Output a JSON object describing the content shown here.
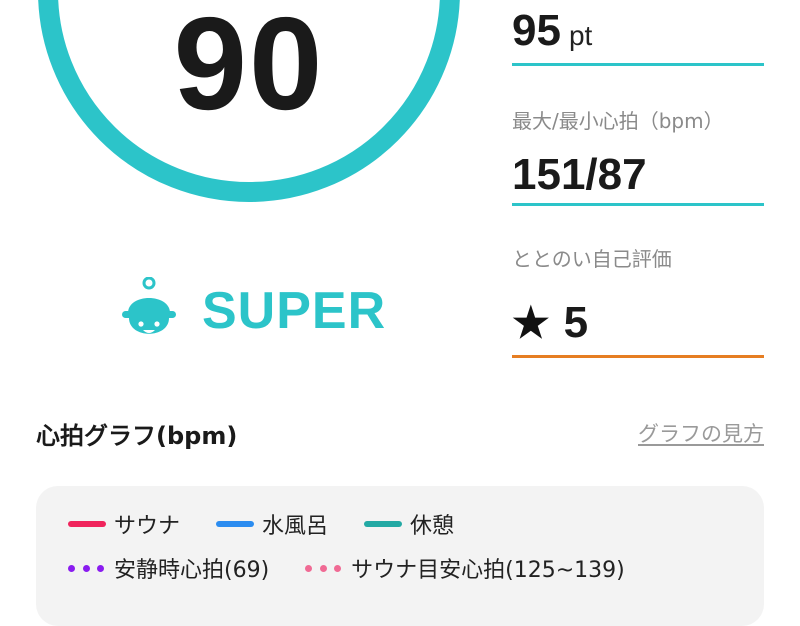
{
  "score": {
    "value": "90",
    "rank": "SUPER",
    "rank_icon": "sauna-hat-mascot-icon",
    "ring_color": "#2cc4c9"
  },
  "stats": {
    "total": {
      "value": "95",
      "unit": "pt"
    },
    "heart_rate": {
      "label": "最大/最小心拍（bpm）",
      "value": "151/87"
    },
    "self_eval": {
      "label": "ととのい自己評価",
      "star": "★",
      "value": "5",
      "underline_color": "#e67e22"
    }
  },
  "graph": {
    "title": "心拍グラフ(bpm)",
    "help_link": "グラフの見方",
    "legend": [
      {
        "label": "サウナ",
        "style": "line",
        "color": "#f0245c"
      },
      {
        "label": "水風呂",
        "style": "line",
        "color": "#2b8cf0"
      },
      {
        "label": "休憩",
        "style": "line",
        "color": "#23a9a4"
      },
      {
        "label": "安静時心拍(69)",
        "style": "dots",
        "color": "#8a1cf0"
      },
      {
        "label": "サウナ目安心拍(125~139)",
        "style": "dots",
        "color": "#f06a94"
      }
    ]
  }
}
